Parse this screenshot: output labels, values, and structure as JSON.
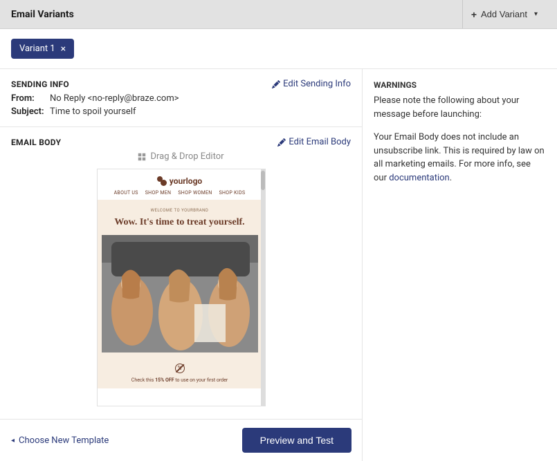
{
  "header": {
    "title": "Email Variants",
    "add_variant_label": "Add Variant"
  },
  "tabs": {
    "variant1_label": "Variant 1"
  },
  "sending_info": {
    "title": "SENDING INFO",
    "edit_label": "Edit Sending Info",
    "from_label": "From:",
    "from_value": "No Reply <no-reply@braze.com>",
    "subject_label": "Subject:",
    "subject_value": "Time to spoil yourself"
  },
  "email_body": {
    "title": "EMAIL BODY",
    "edit_label": "Edit Email Body",
    "editor_type": "Drag & Drop Editor"
  },
  "preview": {
    "logo_text": "yourlogo",
    "nav": {
      "about": "ABOUT US",
      "men": "SHOP MEN",
      "women": "SHOP WOMEN",
      "kids": "SHOP KIDS"
    },
    "welcome": "WELCOME TO YOURBRAND",
    "headline": "Wow. It's time to treat yourself.",
    "promo_prefix": "Check this ",
    "promo_bold": "15% OFF",
    "promo_suffix": " to use on your first order"
  },
  "warnings": {
    "title": "WARNINGS",
    "intro": "Please note the following about your message before launching:",
    "body_prefix": "Your Email Body does not include an unsubscribe link. This is required by law on all marketing emails. For more info, see our ",
    "doc_link": "documentation",
    "body_suffix": "."
  },
  "footer": {
    "choose_template": "Choose New Template",
    "preview_test": "Preview and Test"
  }
}
